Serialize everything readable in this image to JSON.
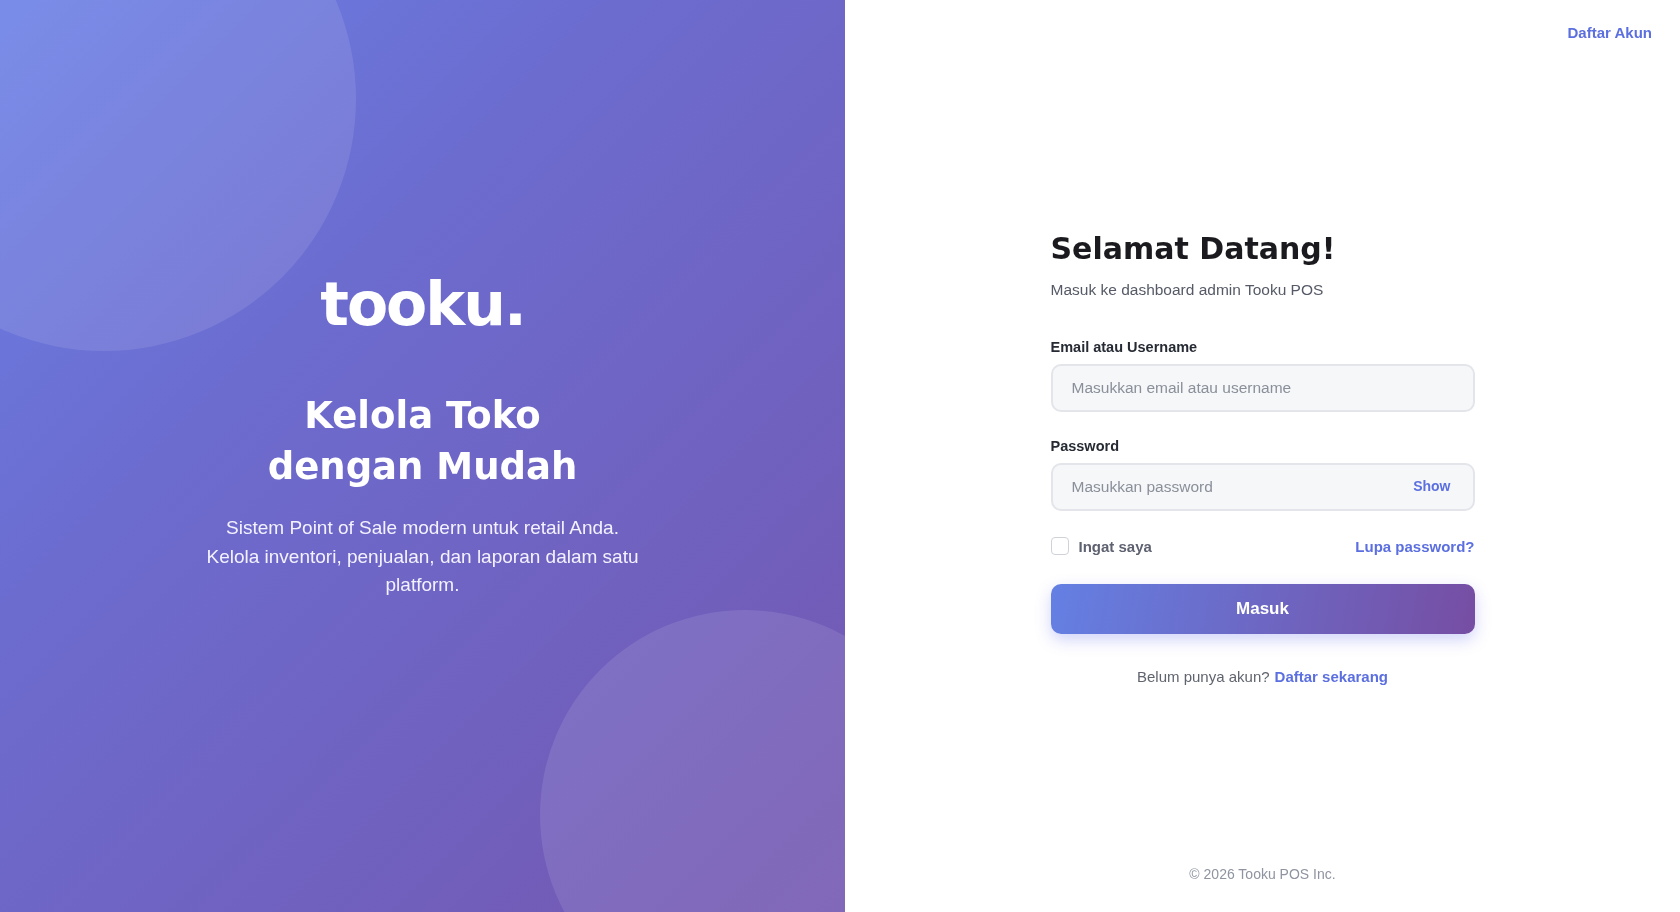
{
  "brand": {
    "logo": "tooku.",
    "headline_lines": [
      "Kelola Toko",
      "dengan Mudah"
    ],
    "description": "Sistem Point of Sale modern untuk retail Anda. Kelola inventori, penjualan, dan laporan dalam satu platform."
  },
  "top_link": "Daftar Akun",
  "form": {
    "title": "Selamat Datang!",
    "subtitle": "Masuk ke dashboard admin Tooku POS",
    "fields": [
      {
        "label": "Email atau Username",
        "placeholder": "Masukkan email atau username"
      },
      {
        "label": "Password",
        "placeholder": "Masukkan password",
        "toggle": "Show"
      }
    ],
    "remember": {
      "label": "Ingat saya",
      "checked": false
    },
    "forgot": "Lupa password?",
    "submit": "Masuk",
    "signup_prompt": "Belum punya akun?",
    "signup_link": "Daftar sekarang"
  },
  "footer": "© 2026 Tooku POS Inc."
}
